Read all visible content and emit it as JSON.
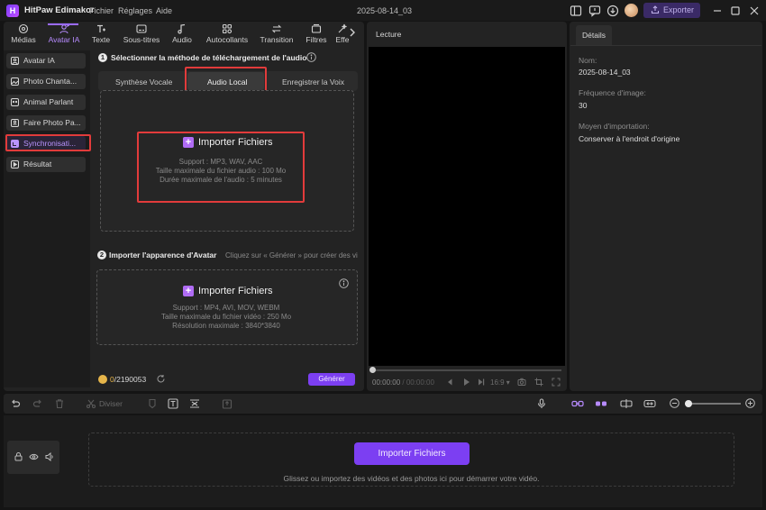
{
  "app": {
    "name": "HitPaw Edimakor",
    "menu": [
      "Fichier",
      "Réglages",
      "Aide"
    ],
    "document_title": "2025-08-14_03",
    "export_label": "Exporter"
  },
  "tabs": [
    {
      "label": "Médias",
      "icon": "media-icon"
    },
    {
      "label": "Avatar IA",
      "icon": "avatar-ai-icon"
    },
    {
      "label": "Texte",
      "icon": "text-icon"
    },
    {
      "label": "Sous-titres",
      "icon": "subtitles-icon"
    },
    {
      "label": "Audio",
      "icon": "music-note-icon"
    },
    {
      "label": "Autocollants",
      "icon": "stickers-icon"
    },
    {
      "label": "Transition",
      "icon": "transition-icon"
    },
    {
      "label": "Filtres",
      "icon": "filter-icon"
    },
    {
      "label": "Effe",
      "icon": "effects-icon"
    }
  ],
  "active_tab": "Avatar IA",
  "sidebar": {
    "items": [
      {
        "label": "Avatar IA",
        "icon": "avatar-icon"
      },
      {
        "label": "Photo Chanta...",
        "icon": "photo-icon"
      },
      {
        "label": "Animal Parlant",
        "icon": "animal-icon"
      },
      {
        "label": "Faire Photo Pa...",
        "icon": "photo-talk-icon"
      },
      {
        "label": "Synchronisati...",
        "icon": "lip-sync-icon"
      },
      {
        "label": "Résultat",
        "icon": "result-icon"
      }
    ],
    "active": "Synchronisati..."
  },
  "step1": {
    "number": "1",
    "title": "Sélectionner la méthode de téléchargement de l'audio",
    "subtabs": [
      "Synthèse Vocale",
      "Audio Local",
      "Enregistrer la Voix"
    ],
    "active_subtab": "Audio Local",
    "import_label": "Importer Fichiers",
    "info_lines": [
      "Support : MP3, WAV, AAC",
      "Taille maximale du fichier audio : 100 Mo",
      "Durée maximale de l'audio : 5 minutes"
    ]
  },
  "step2": {
    "number": "2",
    "title": "Importer l'apparence d'Avatar",
    "hint": "Cliquez sur « Générer » pour créer des vi",
    "import_label": "Importer Fichiers",
    "info_lines": [
      "Support : MP4, AVI, MOV, WEBM",
      "Taille maximale du fichier vidéo : 250 Mo",
      "Résolution maximale : 3840*3840"
    ]
  },
  "credits": {
    "current": "0",
    "total": "/2190053"
  },
  "generate_label": "Générer",
  "player": {
    "title": "Lecture",
    "time_current": "00:00:00",
    "time_sep": " / ",
    "time_total": "00:00:00",
    "ratio": "16:9"
  },
  "details": {
    "tab": "Détails",
    "fields": [
      {
        "label": "Nom:",
        "value": "2025-08-14_03"
      },
      {
        "label": "Fréquence d'image:",
        "value": "30"
      },
      {
        "label": "Moyen d'importation:",
        "value": "Conserver à l'endroit d'origine"
      }
    ]
  },
  "toolbar": {
    "split_label": "Diviser"
  },
  "timeline": {
    "import_label": "Importer Fichiers",
    "hint": "Glissez ou importez des vidéos et des photos ici pour démarrer votre vidéo."
  },
  "colors": {
    "accent": "#7c3ff2",
    "highlight": "#e23b3b",
    "panel": "#232323",
    "background": "#141414"
  }
}
